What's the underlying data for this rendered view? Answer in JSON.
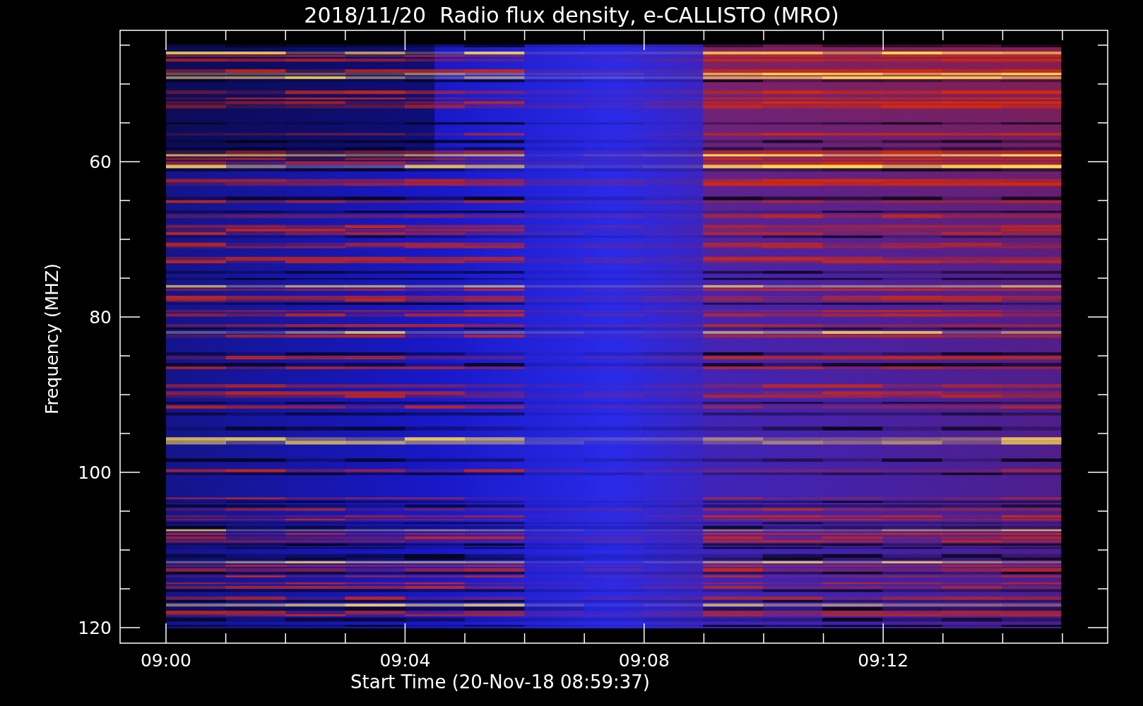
{
  "plot": {
    "title": "2018/11/20  Radio flux density, e-CALLISTO (MRO)",
    "xlabel": "Start Time (20-Nov-18 08:59:37)",
    "ylabel": "Frequency (MHZ)",
    "yticks": [
      "60",
      "80",
      "100",
      "120"
    ],
    "xticks": [
      "09:00",
      "09:04",
      "09:08",
      "09:12"
    ]
  }
}
